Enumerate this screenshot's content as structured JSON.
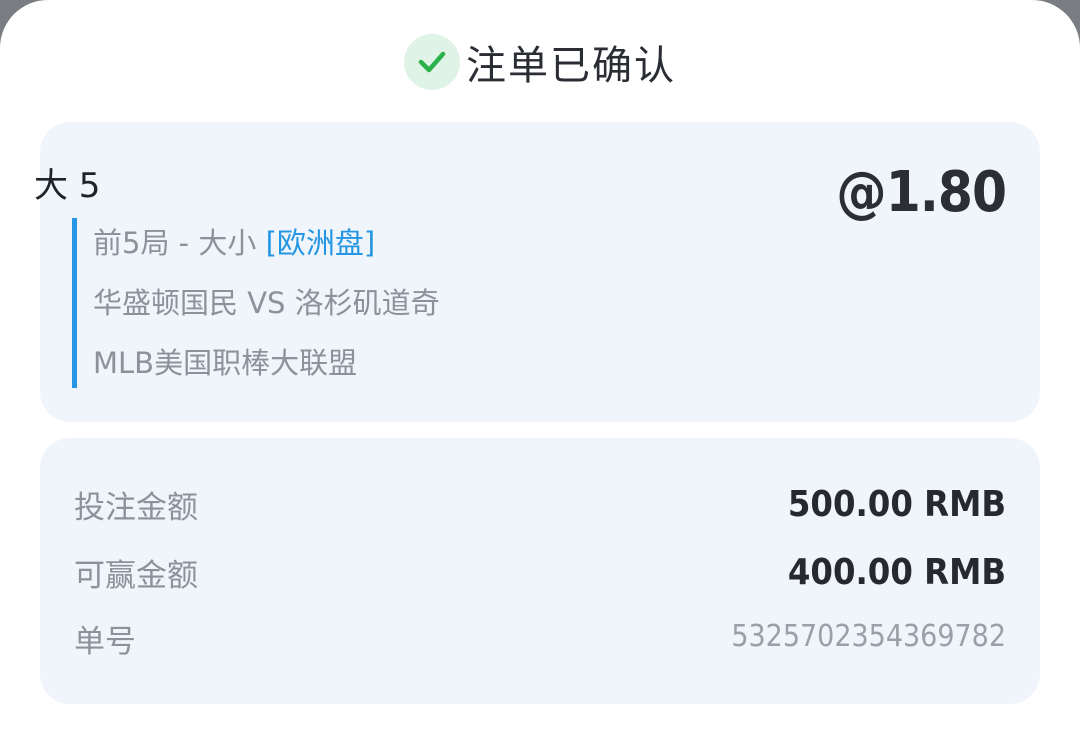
{
  "header": {
    "title": "注单已确认",
    "icon": "check-icon",
    "icon_color": "#2bb24c"
  },
  "bet": {
    "selection": "大 5",
    "odds": "@1.80",
    "market": "前5局 - 大小",
    "market_tag": "[欧洲盘]",
    "match": "华盛顿国民 VS 洛杉矶道奇",
    "league": "MLB美国职棒大联盟"
  },
  "amounts": {
    "stake_label": "投注金额",
    "stake_value": "500.00 RMB",
    "win_label": "可赢金额",
    "win_value": "400.00 RMB",
    "ticket_label": "单号",
    "ticket_value": "5325702354369782"
  },
  "colors": {
    "accent": "#2596e3",
    "card_bg": "#eff5fb",
    "success": "#2bb24c"
  }
}
